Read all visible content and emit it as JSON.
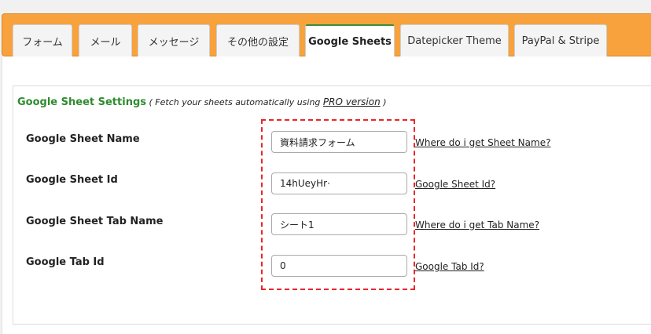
{
  "tabs": [
    {
      "label": "フォーム",
      "active": false
    },
    {
      "label": "メール",
      "active": false
    },
    {
      "label": "メッセージ",
      "active": false
    },
    {
      "label": "その他の設定",
      "active": false
    },
    {
      "label": "Google Sheets",
      "active": true
    },
    {
      "label": "Datepicker Theme",
      "active": false
    },
    {
      "label": "PayPal & Stripe",
      "active": false
    }
  ],
  "settings": {
    "title": "Google Sheet Settings",
    "note_prefix": " ( Fetch your sheets automatically using ",
    "pro_link": "PRO version",
    "note_suffix": " )"
  },
  "fields": [
    {
      "label": "Google Sheet Name",
      "value": "資料請求フォーム",
      "help": "Where do i get Sheet Name?"
    },
    {
      "label": "Google Sheet Id",
      "value": "14hUeyHr·",
      "help": "Google Sheet Id?"
    },
    {
      "label": "Google Sheet Tab Name",
      "value": "シート1",
      "help": "Where do i get Tab Name?"
    },
    {
      "label": "Google Tab Id",
      "value": "0",
      "help": "Google Tab Id?"
    }
  ],
  "colors": {
    "tabbar": "#f7a23c",
    "heading": "#2e8b2e",
    "highlight": "#e8262a"
  }
}
